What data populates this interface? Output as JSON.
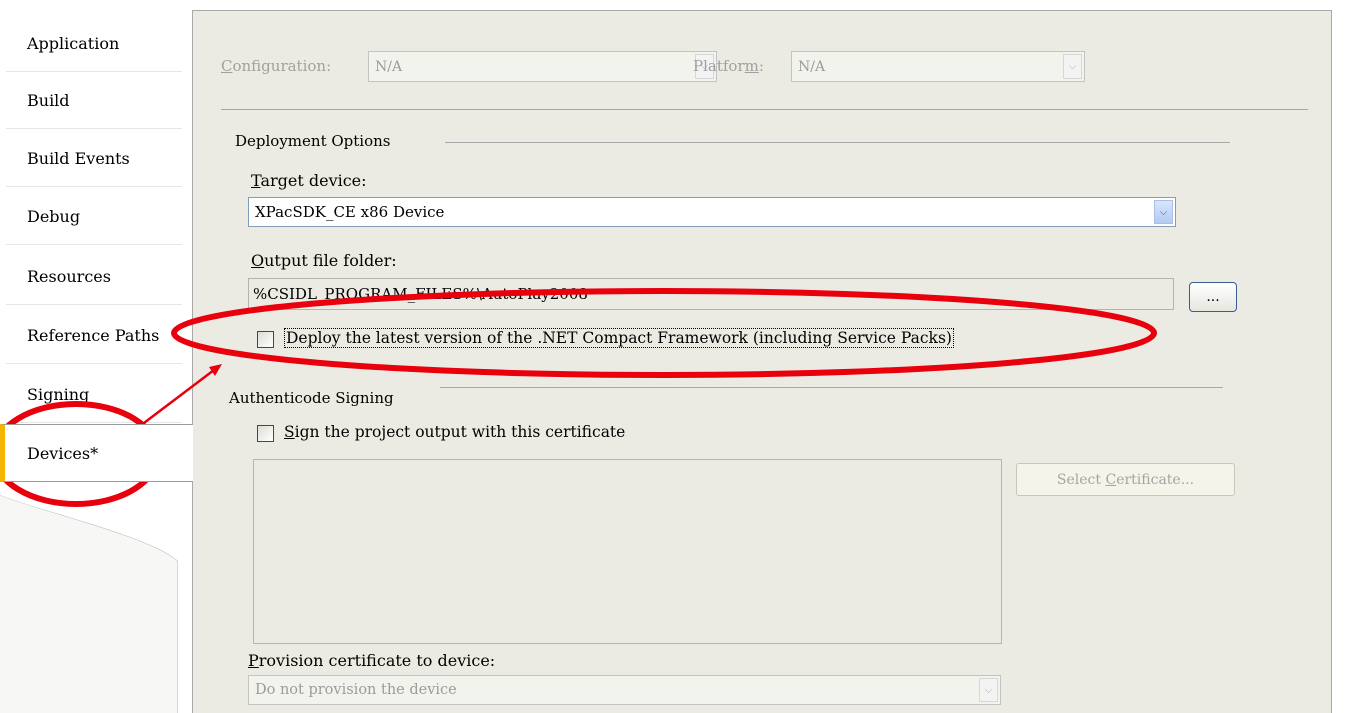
{
  "tabs": {
    "items": [
      {
        "label": "Application"
      },
      {
        "label": "Build"
      },
      {
        "label": "Build Events"
      },
      {
        "label": "Debug"
      },
      {
        "label": "Resources"
      },
      {
        "label": "Reference Paths"
      },
      {
        "label": "Signing"
      },
      {
        "label": "Devices*"
      }
    ],
    "active": "Devices*"
  },
  "header": {
    "configuration_label_prefix": "",
    "configuration_label_u": "C",
    "configuration_label_rest": "onfiguration:",
    "configuration_value": "N/A",
    "platform_label_prefix": "Platfor",
    "platform_label_u": "m",
    "platform_label_rest": ":",
    "platform_value": "N/A"
  },
  "deployment": {
    "group_title": "Deployment Options",
    "target_label_u": "T",
    "target_label_rest": "arget device:",
    "target_value": "XPacSDK_CE x86 Device",
    "output_label_u": "O",
    "output_label_rest": "utput file folder:",
    "output_value": "%CSIDL_PROGRAM_FILES%\\AutoPlay2008",
    "browse_label": "...",
    "deploy_cf_label": "Deploy the latest version of the .NET Compact Framework (including Service Packs)"
  },
  "authenticode": {
    "group_title": "Authenticode Signing",
    "sign_label_u": "S",
    "sign_label_rest": "ign the project output with this certificate",
    "select_cert_prefix": "Select ",
    "select_cert_u": "C",
    "select_cert_rest": "ertificate...",
    "provision_label_u": "P",
    "provision_label_rest": "rovision certificate to device:",
    "provision_value": "Do not provision the device"
  },
  "colors": {
    "annotation": "#e8000d",
    "active_tab_accent": "#f4b400",
    "page_background": "#ecebe3"
  }
}
